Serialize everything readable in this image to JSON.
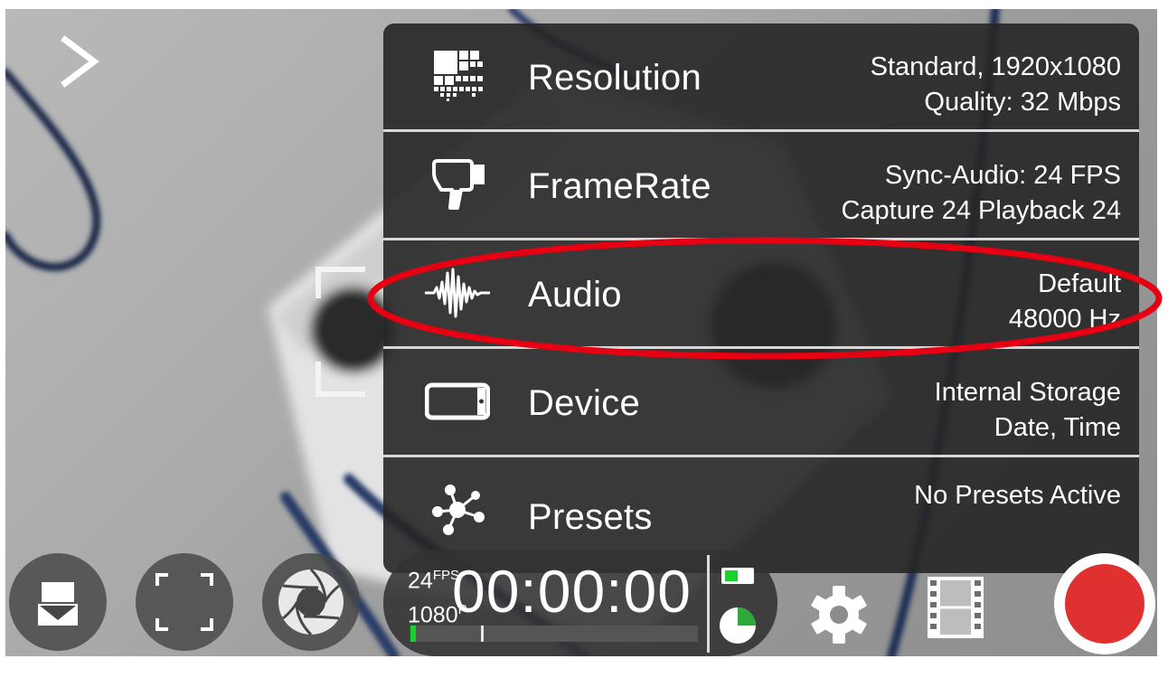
{
  "nav": {
    "toggle_icon": "chevron-right-icon"
  },
  "settings_menu": {
    "items": [
      {
        "id": "resolution",
        "icon": "resolution-grid-icon",
        "label": "Resolution",
        "value_line1": "Standard, 1920x1080",
        "value_line2": "Quality: 32 Mbps"
      },
      {
        "id": "framerate",
        "icon": "camera-icon",
        "label": "FrameRate",
        "value_line1": "Sync-Audio: 24 FPS",
        "value_line2": "Capture 24 Playback 24"
      },
      {
        "id": "audio",
        "icon": "waveform-icon",
        "label": "Audio",
        "value_line1": "Default",
        "value_line2": "48000 Hz"
      },
      {
        "id": "device",
        "icon": "phone-landscape-icon",
        "label": "Device",
        "value_line1": "Internal Storage",
        "value_line2": "Date, Time"
      },
      {
        "id": "presets",
        "icon": "molecule-icon",
        "label": "Presets",
        "value_line1": "No Presets Active",
        "value_line2": ""
      }
    ]
  },
  "status": {
    "fps": "24",
    "fps_unit": "FPS",
    "resolution": "1080",
    "resolution_unit": "P",
    "timer": "00:00:00",
    "audio_level": 0.02
  },
  "toolbar": {
    "icons": [
      "download-tray-icon",
      "fullscreen-icon",
      "aperture-icon",
      "battery-icon",
      "storage-pie-icon",
      "gear-icon",
      "filmstrip-icon",
      "record-icon"
    ]
  },
  "colors": {
    "record": "#e03131",
    "meter": "#18d12a",
    "annotation": "#e60012"
  }
}
